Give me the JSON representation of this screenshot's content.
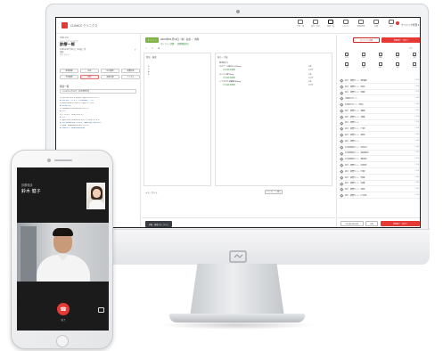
{
  "app": {
    "brand": "CLINICS クリニクス",
    "nav": [
      {
        "icon": "calendar-icon",
        "label": "予約一覧"
      },
      {
        "icon": "list-icon",
        "label": "受付・会計"
      },
      {
        "icon": "chart-icon",
        "label": "患者一覧"
      },
      {
        "icon": "inbox-icon",
        "label": "レセプト"
      },
      {
        "icon": "user-icon",
        "label": "患者管理"
      },
      {
        "icon": "doc-icon",
        "label": "文書"
      },
      {
        "icon": "gear-icon",
        "label": "設定"
      }
    ],
    "user_menu": "クリニック管理 ▾"
  },
  "patient": {
    "id_line": "0001234",
    "kana": "シンリョウ イチロウ",
    "name": "診療一郎",
    "meta1": "1980年01月01日（44歳）男",
    "meta2": "保険",
    "meta3": "オンライン"
  },
  "left_buttons": [
    "患者情報",
    "病名",
    "処方履歴",
    "検査結果",
    "予約履歴",
    "問診",
    "画像文書",
    "バイタル"
  ],
  "left_section_title": "問診一覧",
  "left_select": "2024年01月10日 | 初診用問診票",
  "questions": [
    {
      "q": "Q. 本日はどのような症状で受診されましたか？",
      "a": "A. 喉の痛みと咳",
      "type": "q"
    },
    {
      "q": "A. 咳が続いています（3日間程度）です。",
      "type": "a"
    },
    {
      "q": "Q. 症状が始まったのはいつ頃からですか？",
      "type": "q"
    },
    {
      "q": "A. 3日前から",
      "type": "a"
    },
    {
      "q": "Q. 現在服用中のお薬はありますか？",
      "type": "q"
    },
    {
      "q": "A. なし",
      "type": "a"
    },
    {
      "q": "Q. アレルギーはありますか？",
      "type": "q"
    },
    {
      "q": "A. なし",
      "type": "a"
    },
    {
      "q": "Q. 過去に大きな病気をされたことはありますか？",
      "type": "q"
    },
    {
      "q": "A. 特に既往歴はありません（健康診断で異常なし）",
      "type": "a"
    },
    {
      "q": "Q. 喫煙・飲酒の習慣はありますか？",
      "type": "q"
    },
    {
      "q": "A. 喫煙なし／飲酒は機会飲酒",
      "type": "a"
    }
  ],
  "visit": {
    "status": "オンライン",
    "title": "2024年01月10日（水）初診 ／ 内科",
    "subtitle": "オンライン診療 ・ 診察開始待ち"
  },
  "toolbar_icons": "✓ ✎ ⊞",
  "soap": {
    "header": "所見・検査",
    "lines": [
      "S:",
      "O:",
      "A:",
      "P:"
    ]
  },
  "rx": {
    "header": "処方・手技",
    "rows": [
      {
        "name": "院内処方 1",
        "qty": "",
        "sub": false
      },
      {
        "name": "カロナール錠200 200mg",
        "qty": "3錠",
        "sub": false
      },
      {
        "name": "1日3回 毎食後",
        "qty": "5日分",
        "sub": true
      },
      {
        "name": "メジコン錠15mg",
        "qty": "3錠",
        "sub": false
      },
      {
        "name": "1日3回 毎食後",
        "qty": "5日分",
        "sub": true
      },
      {
        "name": "トラネキサム酸錠250mg",
        "qty": "3錠",
        "sub": false
      },
      {
        "name": "1日3回 毎食後",
        "qty": "5日分",
        "sub": true
      }
    ]
  },
  "memo": {
    "label": "メモ・カルテ",
    "button": "テンプレート挿入"
  },
  "footer_left": "予約・再診 オンライン",
  "right": {
    "outline_button": "オンライン診療",
    "red_button": "診察終了・会計へ",
    "tag": "タグ",
    "grid": [
      {
        "icon": "doc-icon",
        "label": "処方"
      },
      {
        "icon": "pen-icon",
        "label": "病名"
      },
      {
        "icon": "flask-icon",
        "label": "検査"
      },
      {
        "icon": "syringe-icon",
        "label": "注射"
      },
      {
        "icon": "list-icon",
        "label": "手技"
      },
      {
        "icon": "clip-icon",
        "label": "文書"
      },
      {
        "icon": "image-icon",
        "label": "画像"
      },
      {
        "icon": "user-icon",
        "label": "紹介"
      },
      {
        "icon": "calendar-icon",
        "label": "予約"
      },
      {
        "icon": "gear-icon",
        "label": "その他"
      }
    ],
    "docs": [
      {
        "t": "処方・検査セット（咽頭痛）",
        "d": "1234"
      },
      {
        "t": "処方・検査セット（発熱）",
        "d": "1234"
      },
      {
        "t": "処方・検査セット（咳嗽）",
        "d": "1234"
      },
      {
        "t": "内服処方セット",
        "d": "1234"
      },
      {
        "t": "外用処方セット（湿布）",
        "d": "1234"
      },
      {
        "t": "処方・検査セット（腹痛）",
        "d": "1234"
      },
      {
        "t": "処方・検査セット（頭痛）",
        "d": "1234"
      },
      {
        "t": "処方・検査セット",
        "d": "1234"
      },
      {
        "t": "処方・検査セット（下痢）",
        "d": "1234"
      },
      {
        "t": "処方・検査セット（便秘）",
        "d": "1234"
      },
      {
        "t": "処方・検査セット",
        "d": "1234"
      },
      {
        "t": "生活習慣病セット（高血圧）",
        "d": "1234"
      },
      {
        "t": "生活習慣病セット（脂質異常）",
        "d": "1234"
      },
      {
        "t": "生活習慣病セット（糖尿病）",
        "d": "1234"
      },
      {
        "t": "処方・検査セット（花粉症）",
        "d": "1234"
      },
      {
        "t": "処方・検査セット（不眠）",
        "d": "1234"
      },
      {
        "t": "処方・検査セット（胃痛）",
        "d": "1234"
      },
      {
        "t": "処方・検査セット（皮膚）",
        "d": "1234"
      },
      {
        "t": "処方・検査セット（湿疹）",
        "d": "1234"
      },
      {
        "t": "処方・検査セット（その他）",
        "d": "1234"
      }
    ],
    "footer": [
      "処方箋をFAX送信",
      "印刷",
      "診察終了・会計へ"
    ]
  },
  "phone": {
    "label": "診察相手",
    "name": "鈴木 健子",
    "end_label": "終了"
  }
}
